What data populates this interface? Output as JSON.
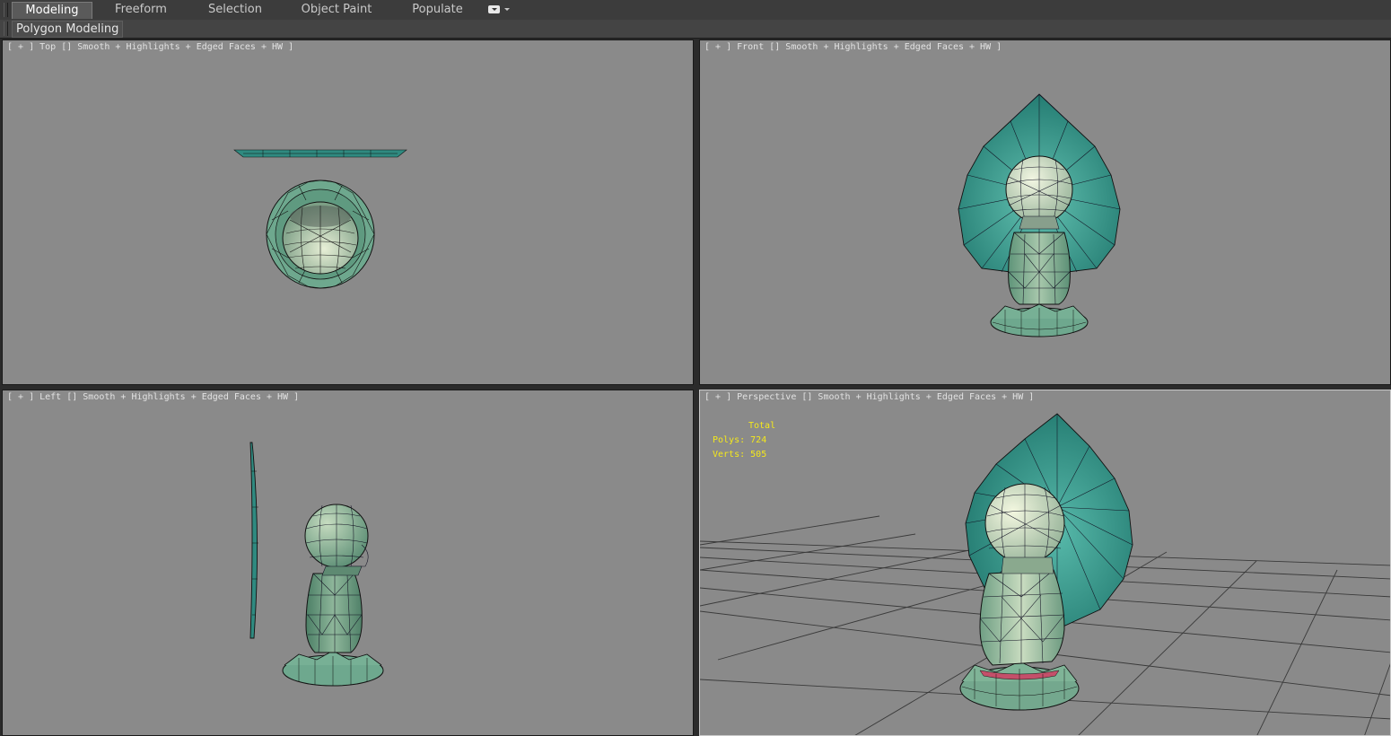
{
  "ribbon": {
    "tabs": [
      {
        "label": "Modeling",
        "active": true
      },
      {
        "label": "Freeform",
        "active": false
      },
      {
        "label": "Selection",
        "active": false
      },
      {
        "label": "Object Paint",
        "active": false
      },
      {
        "label": "Populate",
        "active": false
      }
    ],
    "panel_label": "Polygon Modeling"
  },
  "viewports": {
    "top": {
      "label": "[ + ] Top [] Smooth + Highlights + Edged Faces + HW ]"
    },
    "front": {
      "label": "[ + ] Front [] Smooth + Highlights + Edged Faces + HW ]"
    },
    "left": {
      "label": "[ + ] Left [] Smooth + Highlights + Edged Faces + HW ]"
    },
    "perspective": {
      "label": "[ + ] Perspective [] Smooth + Highlights + Edged Faces + HW ]"
    }
  },
  "stats": {
    "header": "Total",
    "polys_label": "Polys:",
    "polys_value": "724",
    "verts_label": "Verts:",
    "verts_value": "505"
  },
  "colors": {
    "viewport_bg": "#8a8a8a",
    "model_green": "#6ea88e",
    "model_teal": "#2e8a80",
    "model_head": "#d6e2c4",
    "stats_text": "#f4e81c",
    "active_tab": "#5a5a5a"
  },
  "icons": {
    "tab_dropdown": "dropdown-icon"
  }
}
